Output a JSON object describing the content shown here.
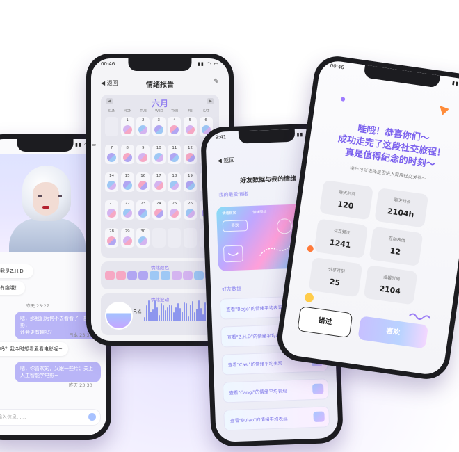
{
  "phone1": {
    "status_time": "",
    "messages": [
      {
        "type": "in",
        "text": "可哦，我是Z.H.D~"
      },
      {
        "type": "in",
        "text": "情绪很有趣哦！"
      },
      {
        "type": "ts",
        "text": "昨天 23:27"
      },
      {
        "type": "out",
        "text": "嗯，那我们为何不去看看了一部电影，\n还会更有趣吗？"
      },
      {
        "type": "ts",
        "text": "日本 23:30"
      },
      {
        "type": "in",
        "text": "看电影吗？我今时想看爱看电影呢~"
      },
      {
        "type": "out",
        "text": "嗯，你喜欢的，又跟一些片；关上\n人工智能学电影~"
      },
      {
        "type": "ts",
        "text": "昨天 23:30"
      }
    ],
    "input_placeholder": "输入信息......"
  },
  "phone2": {
    "status_time": "00:46",
    "back_label": "返回",
    "title": "情绪报告",
    "month": "六月",
    "weekdays": [
      "SUN",
      "MON",
      "TUE",
      "WED",
      "THU",
      "FRI",
      "SAT"
    ],
    "days": [
      [
        "",
        "1",
        "2",
        "3",
        "4",
        "5",
        "6"
      ],
      [
        "7",
        "8",
        "9",
        "10",
        "11",
        "12",
        "13"
      ],
      [
        "14",
        "15",
        "16",
        "17",
        "18",
        "19",
        "20"
      ],
      [
        "21",
        "22",
        "23",
        "24",
        "25",
        "26",
        "27"
      ],
      [
        "28",
        "29",
        "30",
        "",
        "",
        "",
        ""
      ]
    ],
    "mood_colors_label": "情绪颜色",
    "mood_wave_label": "情绪波动",
    "mood_score": "54",
    "colors": {
      "pink": "#f6a8c4",
      "purple": "#b1a6f2",
      "blue": "#9ec8f5",
      "lilac": "#d4b4f0"
    }
  },
  "phone3": {
    "status_time": "9:41",
    "back_label": "返回",
    "title": "好友数据与我的情绪",
    "my_mood_label": "我的最爱情绪",
    "holo_tags": [
      "情绪数据",
      "情绪图标"
    ],
    "holo_box_text": "喜欢",
    "friends_label": "好友数据",
    "rows": [
      "查看\"Bego\"的情绪平均表现",
      "查看\"Z.H.D\"的情绪平均表现",
      "查看\"Casi\"的情绪平均表现",
      "查看\"Cangi\"的情绪平均表现",
      "查看\"Bulao\"的情绪平均表现"
    ]
  },
  "phone4": {
    "status_time": "00:46",
    "headline": [
      "哇哦！恭喜你们～",
      "成功走完了这段社交旅程！",
      "真是值得纪念的时刻～"
    ],
    "subtitle": "接作可以选择是否进入深度社交关系～",
    "stats": [
      {
        "label": "聊天时间",
        "value": "120"
      },
      {
        "label": "聊天时长",
        "value": "2104h"
      },
      {
        "label": "交互频次",
        "value": "1241"
      },
      {
        "label": "互动表情",
        "value": "12"
      },
      {
        "label": "分享时刻",
        "value": "25"
      },
      {
        "label": "温馨时刻",
        "value": "2104"
      }
    ],
    "skip_label": "错过",
    "like_label": "喜欢"
  }
}
